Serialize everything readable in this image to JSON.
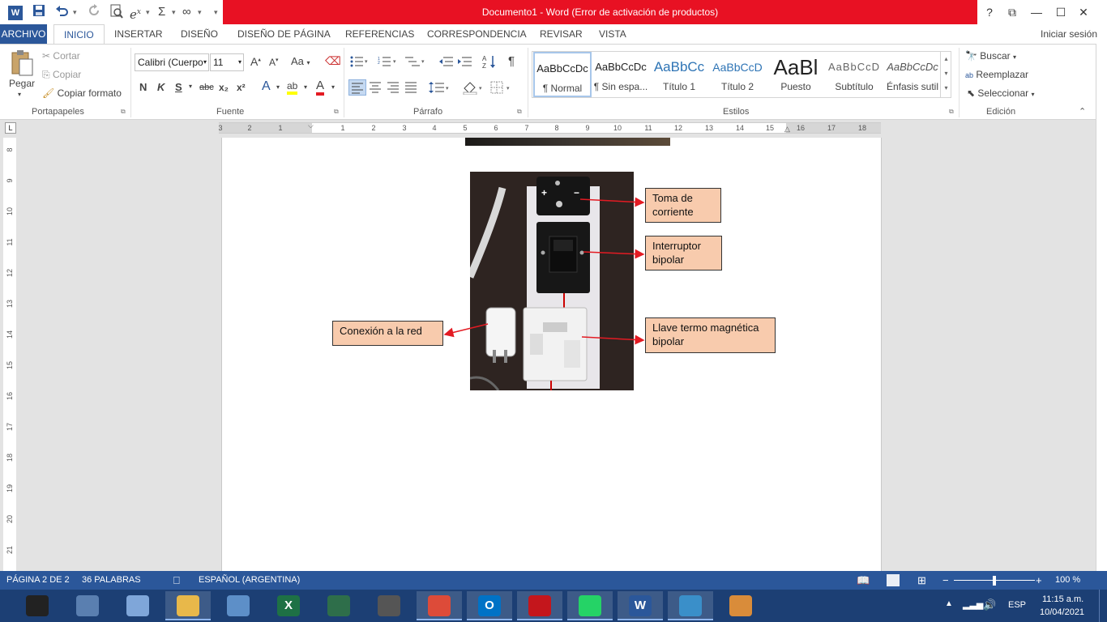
{
  "window": {
    "title": "Documento1 -  Word (Error de activación de productos)",
    "help": "?",
    "restore_ribbon": "⧉",
    "minimize": "—",
    "maximize": "☐",
    "close": "✕"
  },
  "qat": {
    "word_icon": "W",
    "save_icon": "save-icon",
    "undo_icon": "undo-icon",
    "redo_icon": "redo-icon",
    "preview_icon": "print-preview-icon",
    "equation_symbol": "e",
    "equation_sup": "x",
    "sum_symbol": "Σ",
    "infinity_symbol": "∞"
  },
  "tabs": {
    "file": "ARCHIVO",
    "items": [
      "INICIO",
      "INSERTAR",
      "DISEÑO",
      "DISEÑO DE PÁGINA",
      "REFERENCIAS",
      "CORRESPONDENCIA",
      "REVISAR",
      "VISTA"
    ],
    "signin": "Iniciar sesión"
  },
  "ribbon": {
    "clipboard": {
      "paste": "Pegar",
      "cut": "Cortar",
      "copy": "Copiar",
      "format_painter": "Copiar formato",
      "group_label": "Portapapeles"
    },
    "font": {
      "family": "Calibri (Cuerpo",
      "size": "11",
      "grow": "A",
      "shrink": "A",
      "case": "Aa",
      "bold": "N",
      "italic": "K",
      "underline": "S",
      "strike": "abc",
      "subscript": "x₂",
      "superscript": "x²",
      "effects": "A",
      "highlight": "ab",
      "color": "A",
      "group_label": "Fuente"
    },
    "paragraph": {
      "pilcrow": "¶",
      "group_label": "Párrafo"
    },
    "styles": {
      "items": [
        {
          "sample": "AaBbCcDc",
          "name": "¶ Normal"
        },
        {
          "sample": "AaBbCcDc",
          "name": "¶ Sin espa..."
        },
        {
          "sample": "AaBbCc",
          "name": "Título 1"
        },
        {
          "sample": "AaBbCcD",
          "name": "Título 2"
        },
        {
          "sample": "AaBl",
          "name": "Puesto"
        },
        {
          "sample": "AaBbCcD",
          "name": "Subtítulo"
        },
        {
          "sample": "AaBbCcDc",
          "name": "Énfasis sutil"
        }
      ],
      "group_label": "Estilos"
    },
    "editing": {
      "find": "Buscar",
      "replace": "Reemplazar",
      "select": "Seleccionar",
      "group_label": "Edición"
    }
  },
  "ruler": {
    "corner": "L",
    "h_marks": [
      "3",
      "2",
      "1",
      "1",
      "2",
      "3",
      "4",
      "5",
      "6",
      "7",
      "8",
      "9",
      "10",
      "11",
      "12",
      "13",
      "14",
      "15",
      "16",
      "17",
      "18"
    ],
    "v_marks": [
      "8",
      "9",
      "10",
      "11",
      "12",
      "13",
      "14",
      "15",
      "16",
      "17",
      "18",
      "19",
      "20",
      "21"
    ]
  },
  "document": {
    "callouts": {
      "outlet": "Toma de corriente",
      "switch": "Interruptor bipolar",
      "breaker": "Llave termo magnética bipolar",
      "mains": "Conexión a la red"
    }
  },
  "status": {
    "page": "PÁGINA 2 DE 2",
    "words": "36 PALABRAS",
    "language": "ESPAÑOL (ARGENTINA)",
    "zoom": "100 %",
    "zoom_minus": "−",
    "zoom_plus": "+",
    "zoom_fraction": 0.5
  },
  "taskbar": {
    "apps": [
      {
        "name": "camera-icon",
        "label": "",
        "color": "#222222",
        "open": false
      },
      {
        "name": "calculator-icon",
        "label": "",
        "color": "#5a7fb0",
        "open": false
      },
      {
        "name": "notepad-icon",
        "label": "",
        "color": "#7fa6d9",
        "open": false
      },
      {
        "name": "file-explorer-icon",
        "label": "",
        "color": "#e8b84a",
        "open": true
      },
      {
        "name": "control-panel-icon",
        "label": "",
        "color": "#5d8fc8",
        "open": false
      },
      {
        "name": "excel-icon",
        "label": "X",
        "color": "#1e7145",
        "open": false
      },
      {
        "name": "presentation-icon",
        "label": "",
        "color": "#2e6e4a",
        "open": false
      },
      {
        "name": "microphone-icon",
        "label": "",
        "color": "#555555",
        "open": false
      },
      {
        "name": "chrome-icon",
        "label": "",
        "color": "#dd4b39",
        "open": true
      },
      {
        "name": "outlook-icon",
        "label": "O",
        "color": "#0072c6",
        "open": true
      },
      {
        "name": "pdf-reader-icon",
        "label": "",
        "color": "#c4161c",
        "open": true
      },
      {
        "name": "whatsapp-icon",
        "label": "",
        "color": "#25d366",
        "open": true
      },
      {
        "name": "word-icon",
        "label": "W",
        "color": "#2b579a",
        "open": true
      },
      {
        "name": "photos-icon",
        "label": "",
        "color": "#3a8fc9",
        "open": true
      },
      {
        "name": "paint-icon",
        "label": "",
        "color": "#d98c3a",
        "open": false
      }
    ],
    "tray": {
      "language": "ESP",
      "time": "11:15 a.m.",
      "date": "10/04/2021"
    }
  },
  "colors": {
    "accent": "#2b579a",
    "title_error": "#e81123",
    "callout_fill": "#f8cbad",
    "arrow": "#e31b23"
  }
}
